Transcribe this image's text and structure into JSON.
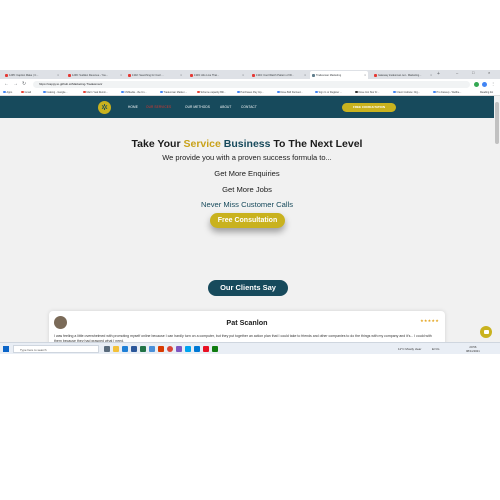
{
  "browser": {
    "tabs": [
      {
        "label": "1295: Caption Make | C..."
      },
      {
        "label": "1296: Sudden Revenue - You..."
      },
      {
        "label": "1302: Searching for Cool ..."
      },
      {
        "label": "1303: Abs Line That..."
      },
      {
        "label": "1304: Cool Watch Pattern of W..."
      },
      {
        "label": "Tradesman Marketing"
      },
      {
        "label": "Gateway tradesman.net - Marketing..."
      }
    ],
    "url": "https://cappy.to.github.io/Marketing-Tradesman/",
    "bookmarks": [
      "Apps",
      "Gmail",
      "lmaking - Google...",
      "Mal 1 Yeal Remin...",
      "CNMedia - the Un...",
      "Tradesman Market ...",
      "Scheme capacity Bill...",
      "Purchases Pay Inp...",
      "Dave Boll Derived...",
      "Sign In or Register ...",
      "Dave Inst Stor Fr...",
      "Client Institute: Org...",
      "Pro Faceup - Wellbe..."
    ],
    "reading_list": "Reading list"
  },
  "site": {
    "nav": {
      "links": [
        {
          "label": "HOME"
        },
        {
          "label": "OUR SERVICES"
        },
        {
          "label": "OUR METHODS"
        },
        {
          "label": "ABOUT"
        },
        {
          "label": "CONTACT"
        }
      ],
      "cta": "FREE CONSULTATION"
    },
    "hero": {
      "title_part1": "Take Your",
      "title_part2": "Service",
      "title_part3": "Business",
      "title_part4": "To The Next Level",
      "subtitle": "We provide you with a proven success formula to...",
      "benefits": [
        "Get More Enquiries",
        "Get More Jobs",
        "Never Miss Customer Calls"
      ],
      "cta": "Free Consultation"
    },
    "testimonials": {
      "heading": "Our Clients Say",
      "name": "Pat Scanlon",
      "stars": "★★★★★",
      "text": "I was feeling a little overwhelmed with promoting myself online because I can hardly turn on a computer, but they put together an action plan that I could take to friends and other companies to do the things with my company and it's... I could with them because they had grasped what I need,"
    }
  },
  "taskbar": {
    "search_placeholder": "Type here to search",
    "weather": "11°C Mostly clear",
    "tray": "ENG",
    "time": "20:56",
    "date": "08/11/2021"
  },
  "colors": {
    "brand_navy": "#174a5c",
    "brand_gold": "#c9b21e",
    "nav_active": "#e2342b"
  }
}
